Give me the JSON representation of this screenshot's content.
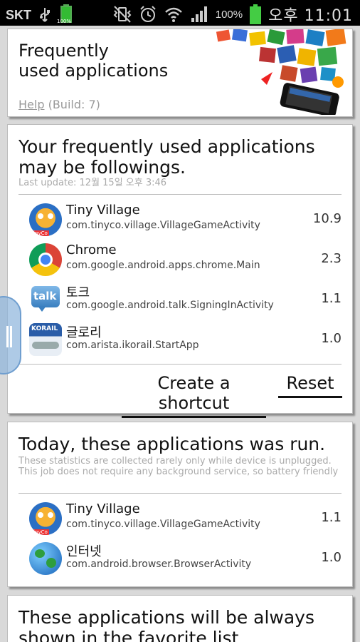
{
  "status_bar": {
    "carrier": "SKT",
    "battery_small_label": "100%",
    "battery_pct": "100%",
    "time": "오후 11:01"
  },
  "header": {
    "title": "Frequently\nused applications",
    "help_link": "Help",
    "build": "(Build: 7)"
  },
  "frequent": {
    "title": "Your frequently used applications may be followings.",
    "last_update": "Last update: 12월 15일 오후 3:46",
    "apps": [
      {
        "name": "Tiny Village",
        "package": "com.tinyco.village.VillageGameActivity",
        "value": "10.9",
        "icon": "tiny-village-icon"
      },
      {
        "name": "Chrome",
        "package": "com.google.android.apps.chrome.Main",
        "value": "2.3",
        "icon": "chrome-icon"
      },
      {
        "name": "토크",
        "package": "com.google.android.talk.SigningInActivity",
        "value": "1.1",
        "icon": "talk-icon"
      },
      {
        "name": "글로리",
        "package": "com.arista.ikorail.StartApp",
        "value": "1.0",
        "icon": "korail-icon"
      }
    ],
    "create_shortcut": "Create a shortcut",
    "reset": "Reset"
  },
  "today": {
    "title": "Today, these applications was run.",
    "note": "These statistics are collected rarely only while device is unplugged. This job does not require any background service, so battery friendly",
    "apps": [
      {
        "name": "Tiny Village",
        "package": "com.tinyco.village.VillageGameActivity",
        "value": "1.1",
        "icon": "tiny-village-icon"
      },
      {
        "name": "인터넷",
        "package": "com.android.browser.BrowserActivity",
        "value": "1.0",
        "icon": "globe-icon"
      }
    ]
  },
  "favorites": {
    "title": "These applications will be always shown in the favorite list"
  },
  "talk_icon_text": "talk",
  "korail_icon_text": "KORAIL",
  "tinyco_badge": "TinyCo"
}
